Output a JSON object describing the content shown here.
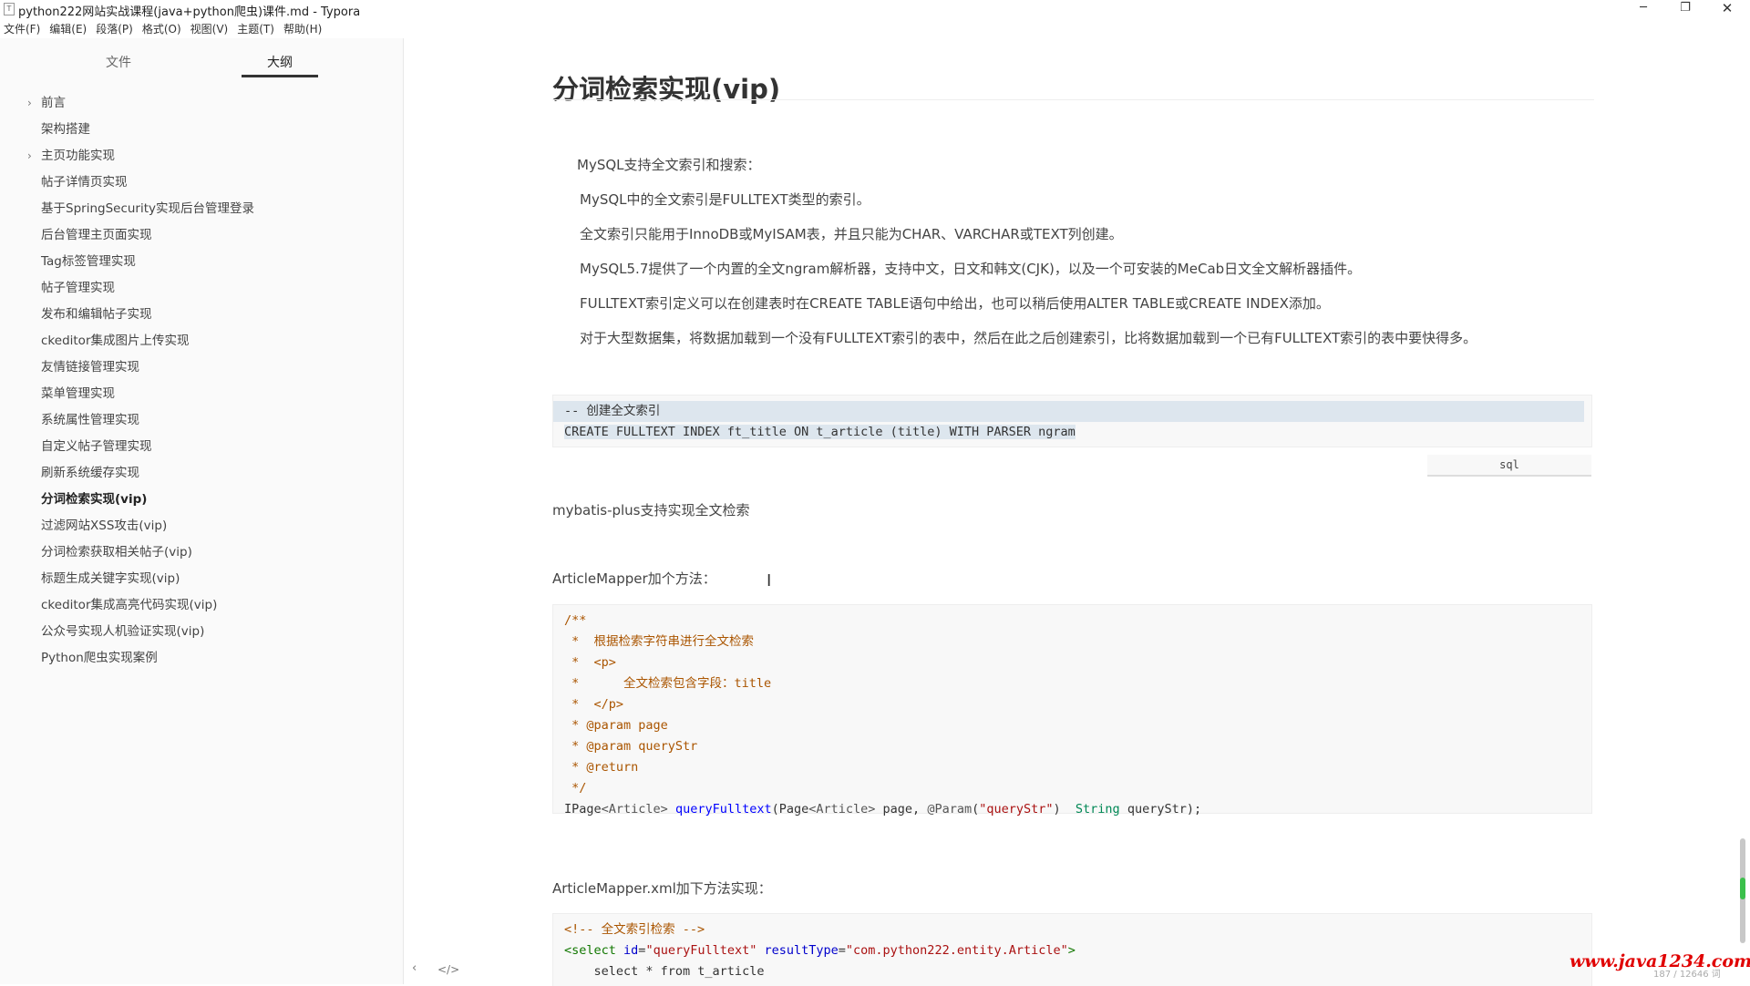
{
  "window": {
    "app_icon": "T",
    "title": "python222网站实战课程(java+python爬虫)课件.md - Typora",
    "controls": {
      "minimize": "─",
      "maximize": "❐",
      "close": "✕"
    }
  },
  "menu": [
    "文件(F)",
    "编辑(E)",
    "段落(P)",
    "格式(O)",
    "视图(V)",
    "主题(T)",
    "帮助(H)"
  ],
  "sidebar": {
    "tabs": {
      "files": "文件",
      "outline": "大纲"
    },
    "items": [
      {
        "label": "前言",
        "expandable": true
      },
      {
        "label": "架构搭建",
        "expandable": false
      },
      {
        "label": "主页功能实现",
        "expandable": true
      },
      {
        "label": "帖子详情页实现",
        "expandable": false
      },
      {
        "label": "基于SpringSecurity实现后台管理登录",
        "expandable": false
      },
      {
        "label": "后台管理主页面实现",
        "expandable": false
      },
      {
        "label": "Tag标签管理实现",
        "expandable": false
      },
      {
        "label": "帖子管理实现",
        "expandable": false
      },
      {
        "label": "发布和编辑帖子实现",
        "expandable": false
      },
      {
        "label": "ckeditor集成图片上传实现",
        "expandable": false
      },
      {
        "label": "友情链接管理实现",
        "expandable": false
      },
      {
        "label": "菜单管理实现",
        "expandable": false
      },
      {
        "label": "系统属性管理实现",
        "expandable": false
      },
      {
        "label": "自定义帖子管理实现",
        "expandable": false
      },
      {
        "label": "刷新系统缓存实现",
        "expandable": false
      },
      {
        "label": "分词检索实现(vip)",
        "expandable": false,
        "active": true
      },
      {
        "label": "过滤网站XSS攻击(vip)",
        "expandable": false
      },
      {
        "label": "分词检索获取相关帖子(vip)",
        "expandable": false
      },
      {
        "label": "标题生成关键字实现(vip)",
        "expandable": false
      },
      {
        "label": "ckeditor集成高亮代码实现(vip)",
        "expandable": false
      },
      {
        "label": "公众号实现人机验证实现(vip)",
        "expandable": false
      },
      {
        "label": "Python爬虫实现案例",
        "expandable": false
      }
    ],
    "footer": {
      "back": "‹",
      "source_mode": "</>"
    }
  },
  "doc": {
    "heading": "分词检索实现(vip)",
    "quote": [
      "MySQL支持全文索引和搜索：",
      "MySQL中的全文索引是FULLTEXT类型的索引。",
      "全文索引只能用于InnoDB或MyISAM表，并且只能为CHAR、VARCHAR或TEXT列创建。",
      "MySQL5.7提供了一个内置的全文ngram解析器，支持中文，日文和韩文(CJK)，以及一个可安装的MeCab日文全文解析器插件。",
      "FULLTEXT索引定义可以在创建表时在CREATE TABLE语句中给出，也可以稍后使用ALTER TABLE或CREATE INDEX添加。",
      "对于大型数据集，将数据加载到一个没有FULLTEXT索引的表中，然后在此之后创建索引，比将数据加载到一个已有FULLTEXT索引的表中要快得多。"
    ],
    "sql_code": {
      "comment": "-- 创建全文索引",
      "statement": "CREATE FULLTEXT INDEX ft_title ON t_article (title) WITH PARSER ngram",
      "lang": "sql"
    },
    "para_mybatis": "mybatis-plus支持实现全文检索",
    "para_mapper": "ArticleMapper加个方法：",
    "java_code": {
      "doc_lines": [
        "/**",
        " *  根据检索字符串进行全文检索",
        " *  <p>",
        " *      全文检索包含字段：title",
        " *  </p>",
        " * @param page",
        " * @param queryStr",
        " * @return",
        " */"
      ],
      "sig_type1": "IPage",
      "sig_generic1": "<Article>",
      "sig_method": "queryFulltext",
      "sig_paren_open": "(",
      "sig_page_type": "Page",
      "sig_generic2": "<Article>",
      "sig_page_arg": " page, ",
      "sig_annotation": "@Param",
      "sig_annotation_open": "(",
      "sig_annotation_value": "\"queryStr\"",
      "sig_annotation_close": ")  ",
      "sig_string_type": "String",
      "sig_tail": " queryStr);"
    },
    "para_xml": "ArticleMapper.xml加下方法实现：",
    "xml_code": {
      "comment": "<!-- 全文索引检索 -->",
      "tag_open": "<select",
      "attr_id": " id",
      "eq1": "=",
      "val_id": "\"queryFulltext\"",
      "attr_result": " resultType",
      "eq2": "=",
      "val_result": "\"com.python222.entity.Article\"",
      "tag_close": ">",
      "select_line": "    select * from t_article"
    }
  },
  "cursor": "I",
  "watermark": "www.java1234.com",
  "wordcount": "187 / 12646 词"
}
